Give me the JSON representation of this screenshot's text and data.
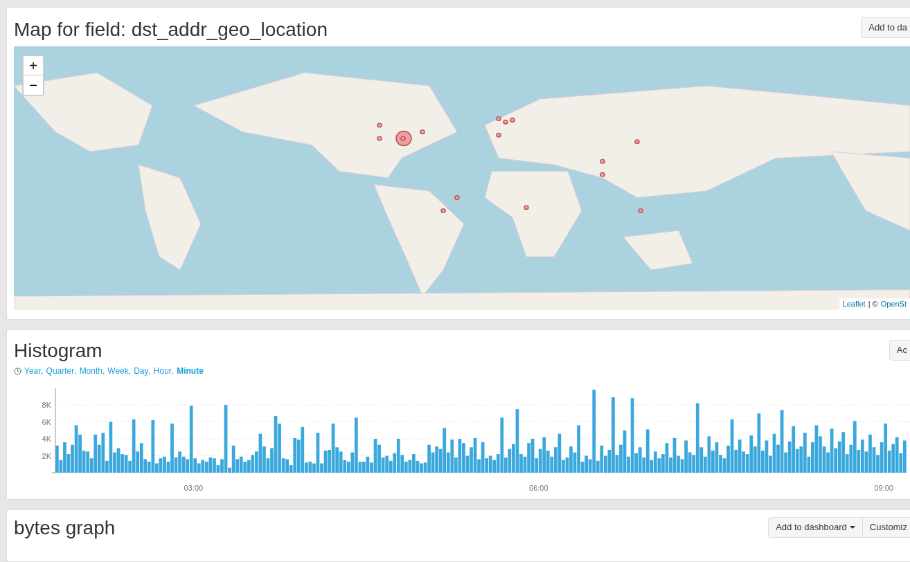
{
  "map_panel": {
    "title": "Map for field: dst_addr_geo_location",
    "button": "Add to da",
    "zoom_in": "+",
    "zoom_out": "−",
    "attribution": {
      "link_1": "Leaflet",
      "separator": "| ©",
      "link_2": "OpenSt"
    }
  },
  "histogram_panel": {
    "title": "Histogram",
    "button": "Ac",
    "separator": ",",
    "intervals": [
      {
        "label": "Year",
        "selected": false
      },
      {
        "label": "Quarter",
        "selected": false
      },
      {
        "label": "Month",
        "selected": false
      },
      {
        "label": "Week",
        "selected": false
      },
      {
        "label": "Day",
        "selected": false
      },
      {
        "label": "Hour",
        "selected": false
      },
      {
        "label": "Minute",
        "selected": true
      }
    ],
    "chart_data": {
      "type": "bar",
      "ylim": [
        0,
        9800
      ],
      "xlim": [
        108,
        554
      ],
      "grid": true,
      "x": [
        108,
        110,
        112,
        114,
        116,
        118,
        120,
        122,
        124,
        126,
        128,
        130,
        132,
        134,
        136,
        138,
        140,
        142,
        144,
        146,
        148,
        150,
        152,
        154,
        156,
        158,
        160,
        162,
        164,
        166,
        168,
        170,
        172,
        174,
        176,
        178,
        180,
        182,
        184,
        186,
        188,
        190,
        192,
        194,
        196,
        198,
        200,
        202,
        204,
        206,
        208,
        210,
        212,
        214,
        216,
        218,
        220,
        222,
        224,
        226,
        228,
        230,
        232,
        234,
        236,
        238,
        240,
        242,
        244,
        246,
        248,
        250,
        252,
        254,
        256,
        258,
        260,
        262,
        264,
        266,
        268,
        270,
        272,
        274,
        276,
        278,
        280,
        282,
        284,
        286,
        288,
        290,
        292,
        294,
        296,
        298,
        300,
        302,
        304,
        306,
        308,
        310,
        312,
        314,
        316,
        318,
        320,
        322,
        324,
        326,
        328,
        330,
        332,
        334,
        336,
        338,
        340,
        342,
        344,
        346,
        348,
        350,
        352,
        354,
        356,
        358,
        360,
        362,
        364,
        366,
        368,
        370,
        372,
        374,
        376,
        378,
        380,
        382,
        384,
        386,
        388,
        390,
        392,
        394,
        396,
        398,
        400,
        402,
        404,
        406,
        408,
        410,
        412,
        414,
        416,
        418,
        420,
        422,
        424,
        426,
        428,
        430,
        432,
        434,
        436,
        438,
        440,
        442,
        444,
        446,
        448,
        450,
        452,
        454,
        456,
        458,
        460,
        462,
        464,
        466,
        468,
        470,
        472,
        474,
        476,
        478,
        480,
        482,
        484,
        486,
        488,
        490,
        492,
        494,
        496,
        498,
        500,
        502,
        504,
        506,
        508,
        510,
        512,
        514,
        516,
        518,
        520,
        522,
        524,
        526,
        528,
        530,
        532,
        534,
        536,
        538,
        540,
        542,
        544,
        546,
        548,
        550
      ],
      "yticks": [
        {
          "value": 2000,
          "label": "2K"
        },
        {
          "value": 4000,
          "label": "4K"
        },
        {
          "value": 6000,
          "label": "6K"
        },
        {
          "value": 8000,
          "label": "8K"
        }
      ],
      "xticks": [
        {
          "value": 180,
          "label": "03:00"
        },
        {
          "value": 360,
          "label": "06:00"
        },
        {
          "value": 540,
          "label": "09:00"
        }
      ],
      "series": [
        {
          "color": "#3aa8dc",
          "values": [
            3200,
            1500,
            3600,
            2200,
            3300,
            5600,
            4500,
            2600,
            2500,
            1700,
            4500,
            3300,
            4700,
            1400,
            6000,
            2400,
            2900,
            2200,
            2100,
            1400,
            6300,
            2500,
            3500,
            1600,
            1300,
            6200,
            1100,
            1700,
            1900,
            1300,
            5800,
            1800,
            2500,
            1900,
            1600,
            7900,
            1700,
            1100,
            1500,
            1300,
            1800,
            1700,
            900,
            1600,
            8000,
            600,
            3200,
            1600,
            1900,
            1300,
            1500,
            2100,
            2500,
            4600,
            3100,
            1700,
            2900,
            6700,
            5800,
            1700,
            1600,
            900,
            4100,
            3900,
            5400,
            1200,
            1300,
            1100,
            4700,
            1100,
            2600,
            2700,
            5800,
            3000,
            2500,
            1500,
            1300,
            2400,
            6500,
            1300,
            1300,
            1900,
            1200,
            4000,
            3300,
            1800,
            2000,
            1400,
            2300,
            4000,
            2100,
            1300,
            1500,
            2200,
            1400,
            1100,
            1200,
            3300,
            2400,
            3100,
            2800,
            5300,
            2400,
            3900,
            1800,
            4000,
            3500,
            2000,
            3000,
            4100,
            1600,
            3600,
            1700,
            2000,
            1500,
            2200,
            6500,
            1800,
            2800,
            3400,
            7500,
            2200,
            1900,
            3500,
            4000,
            1700,
            2800,
            4200,
            2600,
            1900,
            3000,
            4600,
            1500,
            1800,
            3100,
            2400,
            5600,
            1300,
            2000,
            1600,
            9800,
            1400,
            3200,
            2000,
            2700,
            8900,
            2100,
            3300,
            5000,
            1900,
            8800,
            2300,
            3000,
            1800,
            5100,
            1500,
            2500,
            1700,
            2200,
            3500,
            1800,
            4100,
            2000,
            1600,
            3800,
            2400,
            2100,
            8200,
            3000,
            1900,
            4300,
            2600,
            3600,
            2100,
            1700,
            3200,
            6300,
            2700,
            3900,
            2500,
            2200,
            4400,
            3100,
            7000,
            2600,
            3800,
            2000,
            4600,
            3300,
            7400,
            2400,
            3700,
            5500,
            2800,
            3100,
            4700,
            1900,
            3600,
            5600,
            4300,
            3100,
            2400,
            5200,
            2900,
            3700,
            4800,
            2200,
            3300,
            6100,
            2700,
            3900,
            2500,
            4500,
            3000,
            2100,
            3600,
            5800,
            2600,
            3400,
            4200,
            2300,
            3800
          ]
        }
      ]
    }
  },
  "bytes_panel": {
    "title": "bytes graph",
    "buttons": [
      "Add to dashboard",
      "Customiz"
    ]
  }
}
